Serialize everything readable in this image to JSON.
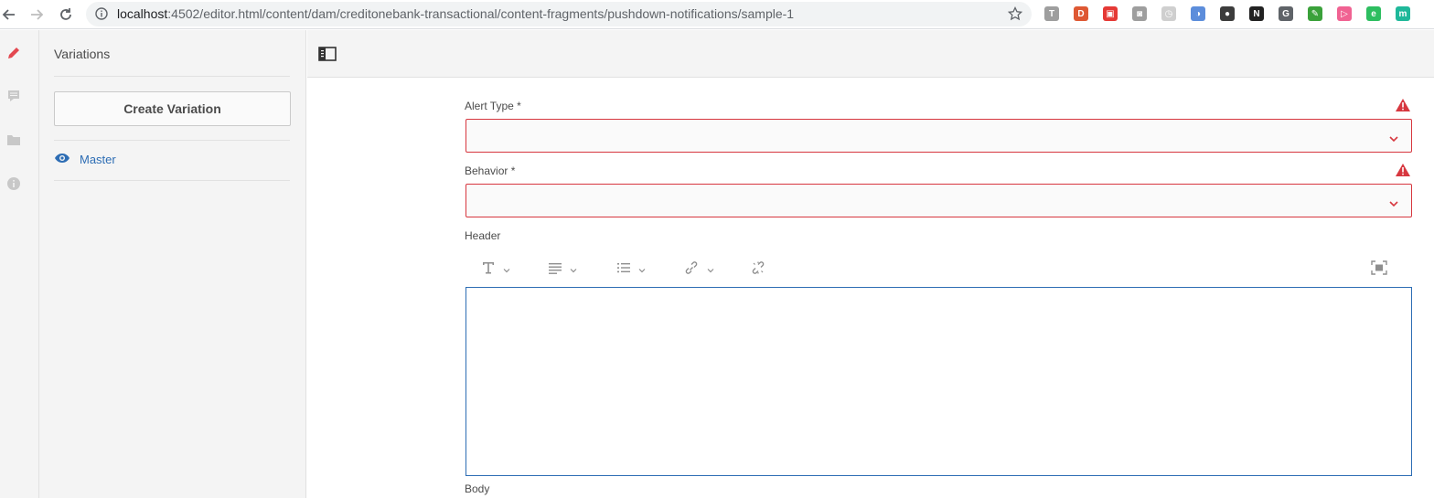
{
  "browser": {
    "url_host": "localhost",
    "url_rest": ":4502/editor.html/content/dam/creditonebank-transactional/content-fragments/pushdown-notifications/sample-1",
    "extensions": [
      {
        "name": "tool-t-icon",
        "color": "#9e9e9e",
        "glyph": "T"
      },
      {
        "name": "duckduckgo-icon",
        "color": "#de5833",
        "glyph": "D"
      },
      {
        "name": "ext-red-icon",
        "color": "#e53935",
        "glyph": "▣"
      },
      {
        "name": "camera-icon",
        "color": "#9e9e9e",
        "glyph": "◙"
      },
      {
        "name": "clock-icon",
        "color": "#cfcfcf",
        "glyph": "◷"
      },
      {
        "name": "ext-blue-icon",
        "color": "#5c8ddb",
        "glyph": "◑"
      },
      {
        "name": "ext-dark-circle-icon",
        "color": "#3c3c3c",
        "glyph": "●"
      },
      {
        "name": "new-badge-icon",
        "color": "#222222",
        "glyph": "N"
      },
      {
        "name": "grammarly-g-icon",
        "color": "#5f6368",
        "glyph": "G"
      },
      {
        "name": "ext-green-tool-icon",
        "color": "#3aa13a",
        "glyph": "✎"
      },
      {
        "name": "ext-pink-icon",
        "color": "#f06292",
        "glyph": "▷"
      },
      {
        "name": "evernote-icon",
        "color": "#2dbe60",
        "glyph": "e"
      },
      {
        "name": "ext-teal-m-icon",
        "color": "#1fb89a",
        "glyph": "m"
      }
    ]
  },
  "panel": {
    "title": "Variations",
    "create_button": "Create Variation",
    "variations": [
      {
        "label": "Master"
      }
    ]
  },
  "form": {
    "fields": [
      {
        "label": "Alert Type *",
        "type": "select",
        "value": "",
        "error": true
      },
      {
        "label": "Behavior *",
        "type": "select",
        "value": "",
        "error": true
      },
      {
        "label": "Header",
        "type": "richtext",
        "value": ""
      },
      {
        "label": "Body",
        "type": "richtext",
        "value": ""
      }
    ]
  },
  "colors": {
    "accent": "#2d6db4",
    "error": "#d7373f",
    "edit_icon": "#e34850"
  }
}
